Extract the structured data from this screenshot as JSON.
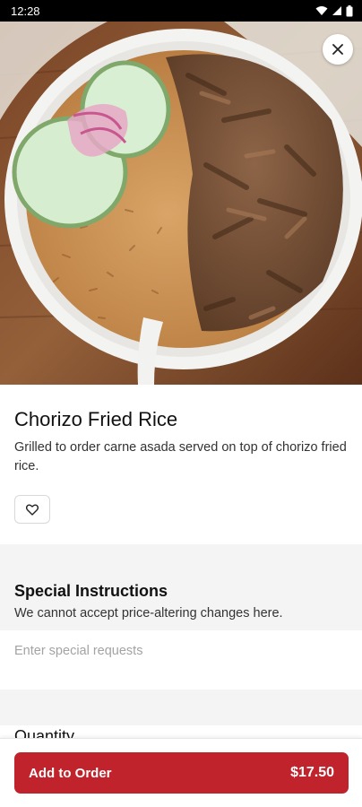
{
  "status_bar": {
    "time": "12:28"
  },
  "item": {
    "title": "Chorizo Fried Rice",
    "description": "Grilled to order carne asada served on top of chorizo fried rice."
  },
  "special_instructions": {
    "title": "Special Instructions",
    "note": "We cannot accept price-altering changes here.",
    "placeholder": "Enter special requests"
  },
  "quantity": {
    "title": "Quantity"
  },
  "order_button": {
    "label": "Add to Order",
    "price": "$17.50"
  },
  "colors": {
    "accent": "#c0232b",
    "section_bg": "#f4f4f4"
  }
}
